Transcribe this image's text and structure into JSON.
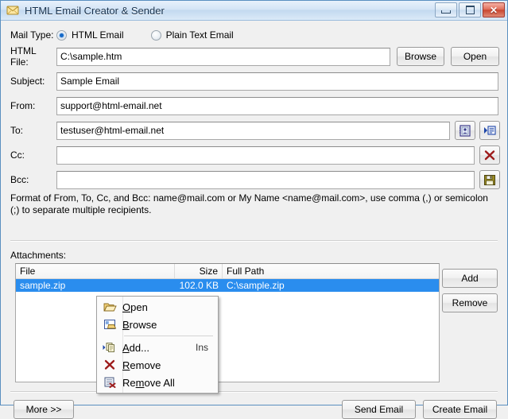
{
  "window": {
    "title": "HTML Email Creator & Sender",
    "icon": "mail-envelope-icon",
    "controls": {
      "minimize": "minimize-button",
      "maximize": "maximize-button",
      "close": "close-button",
      "close_glyph": "✕"
    }
  },
  "form": {
    "mail_type": {
      "label": "Mail Type:",
      "options": [
        {
          "label": "HTML Email",
          "selected": true
        },
        {
          "label": "Plain Text Email",
          "selected": false
        }
      ]
    },
    "html_file": {
      "label": "HTML File:",
      "value": "C:\\sample.htm",
      "placeholder": ""
    },
    "subject": {
      "label": "Subject:",
      "value": "Sample Email",
      "placeholder": ""
    },
    "from": {
      "label": "From:",
      "value": "support@html-email.net",
      "placeholder": ""
    },
    "to": {
      "label": "To:",
      "value": "testuser@html-email.net",
      "placeholder": ""
    },
    "cc": {
      "label": "Cc:",
      "value": "",
      "placeholder": ""
    },
    "bcc": {
      "label": "Bcc:",
      "value": "",
      "placeholder": ""
    },
    "buttons": {
      "browse": "Browse",
      "open": "Open"
    },
    "icon_buttons": {
      "address_book": "address-book-icon",
      "insert_list": "insert-list-icon",
      "clear": "red-x-icon",
      "save": "floppy-save-icon"
    },
    "hint": "Format of From, To, Cc, and Bcc: name@mail.com or My Name <name@mail.com>, use comma (,) or semicolon (;) to separate multiple recipients."
  },
  "attachments": {
    "label": "Attachments:",
    "columns": [
      "File",
      "Size",
      "Full Path"
    ],
    "rows": [
      {
        "file": "sample.zip",
        "size": "102.0 KB",
        "path": "C:\\sample.zip",
        "selected": true
      }
    ],
    "buttons": {
      "add": "Add",
      "remove": "Remove"
    }
  },
  "context_menu": {
    "items": [
      {
        "label": "Open",
        "accel": "",
        "icon": "open-folder-icon",
        "mnemonic": "O"
      },
      {
        "label": "Browse",
        "accel": "",
        "icon": "browse-folder-icon",
        "mnemonic": "B"
      },
      {
        "separator": true
      },
      {
        "label": "Add...",
        "accel": "Ins",
        "icon": "add-copy-icon",
        "mnemonic": "A"
      },
      {
        "label": "Remove",
        "accel": "",
        "icon": "red-x-icon",
        "mnemonic": "R"
      },
      {
        "label": "Remove All",
        "accel": "",
        "icon": "remove-all-icon",
        "mnemonic": "m"
      }
    ]
  },
  "footer": {
    "more": "More >>",
    "send_email": "Send Email",
    "create_email": "Create Email"
  },
  "colors": {
    "selection_blue": "#2a8dee",
    "title_blue": "#16314d",
    "close_red": "#c84730"
  }
}
